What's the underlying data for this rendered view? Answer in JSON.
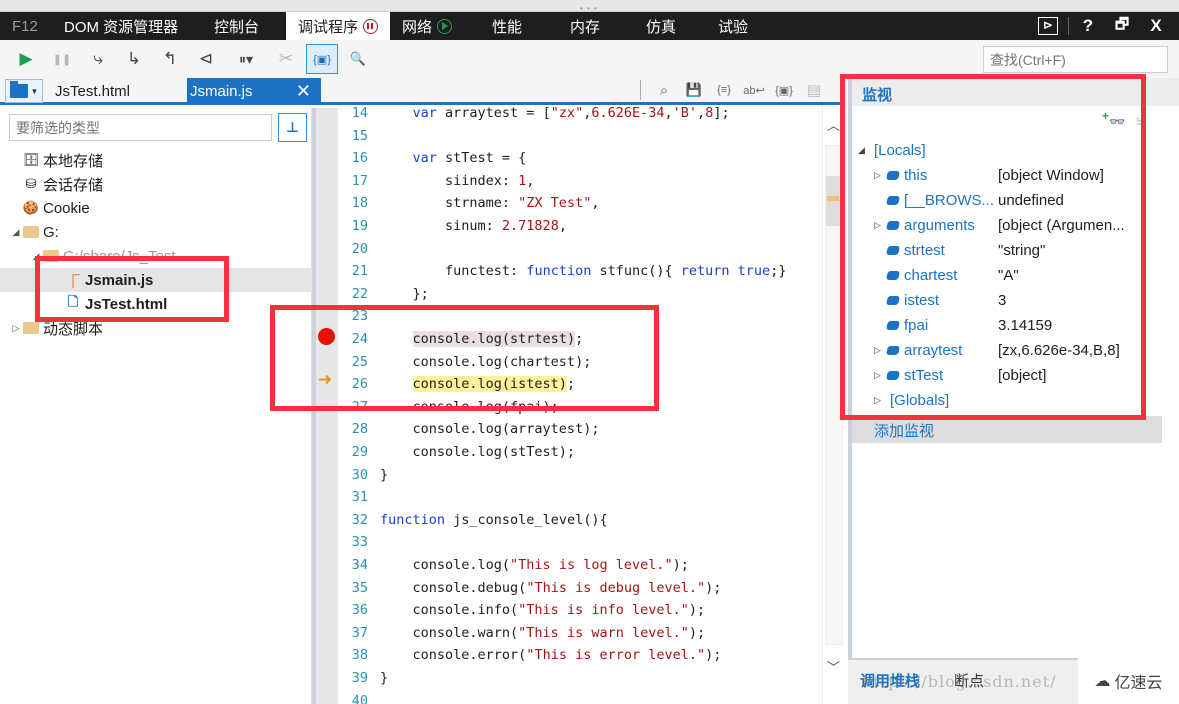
{
  "menubar": {
    "f12": "F12",
    "tabs": [
      "DOM 资源管理器",
      "控制台",
      "调试程序",
      "网络",
      "性能",
      "内存",
      "仿真",
      "试验"
    ],
    "active_tab": "调试程序",
    "right_icons": [
      "console-icon",
      "help-icon",
      "undock-icon",
      "close-icon"
    ],
    "right_glyphs": [
      "⊳",
      "?",
      "🗗",
      "X"
    ]
  },
  "toolbar": {
    "buttons": [
      {
        "name": "continue",
        "glyph": "▶"
      },
      {
        "name": "break-all",
        "glyph": "❚❚"
      },
      {
        "name": "step-into",
        "glyph": "⤷"
      },
      {
        "name": "step-over",
        "glyph": "↳"
      },
      {
        "name": "step-out",
        "glyph": "↰"
      },
      {
        "name": "break-on-new-worker",
        "glyph": "⊲"
      },
      {
        "name": "exception-behavior",
        "glyph": "⏸▾"
      },
      {
        "name": "disconnect-debugger",
        "glyph": "✂"
      },
      {
        "name": "just-my-code",
        "glyph": "{▣}"
      },
      {
        "name": "find-in-files",
        "glyph": "🔍"
      }
    ],
    "find_placeholder": "查找(Ctrl+F)"
  },
  "filetabs": {
    "tabs": [
      {
        "label": "JsTest.html",
        "active": false
      },
      {
        "label": "Jsmain.js",
        "active": true
      }
    ],
    "close_glyph": "✕",
    "editor_icons": [
      "find",
      "save",
      "pretty-print",
      "word-wrap",
      "just-my-code",
      "source-map"
    ],
    "editor_glyphs": [
      "⌕",
      "💾",
      "{≡}",
      "ab↩",
      "{▣}",
      "▤"
    ]
  },
  "left": {
    "filter_placeholder": "要筛选的类型",
    "pin_glyph": "⊥",
    "tree": [
      {
        "label": "本地存储",
        "icon": "local-storage-icon",
        "depth": 1
      },
      {
        "label": "会话存储",
        "icon": "session-storage-icon",
        "depth": 1
      },
      {
        "label": "Cookie",
        "icon": "cookie-icon",
        "depth": 1
      },
      {
        "label": "G:",
        "icon": "folder-icon",
        "depth": 0,
        "expanded": true
      },
      {
        "label": "G:/share/Js_Test",
        "icon": "folder-icon",
        "depth": 1,
        "expanded": true
      },
      {
        "label": "Jsmain.js",
        "icon": "js-file-icon",
        "depth": 2,
        "selected": true
      },
      {
        "label": "JsTest.html",
        "icon": "html-file-icon",
        "depth": 2
      },
      {
        "label": "动态脚本",
        "icon": "folder-icon",
        "depth": 0,
        "expanded": false
      }
    ]
  },
  "code": {
    "breakpoint_line": 24,
    "current_line": 26,
    "lines": [
      {
        "n": "14",
        "html": "    <span class=\"kw\">var</span> arraytest = [<span class=\"str\">\"zx\"</span>,<span class=\"num\">6.626E-34</span>,<span class=\"str\">'B'</span>,<span class=\"num\">8</span>];"
      },
      {
        "n": "15",
        "html": ""
      },
      {
        "n": "16",
        "html": "    <span class=\"kw\">var</span> stTest = {"
      },
      {
        "n": "17",
        "html": "        siindex: <span class=\"num\">1</span>,"
      },
      {
        "n": "18",
        "html": "        strname: <span class=\"str\">\"ZX Test\"</span>,"
      },
      {
        "n": "19",
        "html": "        sinum: <span class=\"num\">2.71828</span>,"
      },
      {
        "n": "20",
        "html": ""
      },
      {
        "n": "21",
        "html": "        functest: <span class=\"kw\">function</span> stfunc(){ <span class=\"kw\">return</span> <span class=\"kw\">true</span>;}"
      },
      {
        "n": "22",
        "html": "    };"
      },
      {
        "n": "23",
        "html": ""
      },
      {
        "n": "24",
        "html": "    <span class=\"hl-bp\">console.log(strtest)</span>;"
      },
      {
        "n": "25",
        "html": "    console.log(chartest);"
      },
      {
        "n": "26",
        "html": "    <span class=\"hl-cur\">console.log(istest)</span>;"
      },
      {
        "n": "27",
        "html": "    console.log(fpai);"
      },
      {
        "n": "28",
        "html": "    console.log(arraytest);"
      },
      {
        "n": "29",
        "html": "    console.log(stTest);"
      },
      {
        "n": "30",
        "html": "}"
      },
      {
        "n": "31",
        "html": ""
      },
      {
        "n": "32",
        "html": "<span class=\"kw\">function</span> js_console_level(){"
      },
      {
        "n": "33",
        "html": ""
      },
      {
        "n": "34",
        "html": "    console.log(<span class=\"str\">\"This is log level.\"</span>);"
      },
      {
        "n": "35",
        "html": "    console.debug(<span class=\"str\">\"This is debug level.\"</span>);"
      },
      {
        "n": "36",
        "html": "    console.info(<span class=\"str\">\"This is info level.\"</span>);"
      },
      {
        "n": "37",
        "html": "    console.warn(<span class=\"str\">\"This is warn level.\"</span>);"
      },
      {
        "n": "38",
        "html": "    console.error(<span class=\"str\">\"This is error level.\"</span>);"
      },
      {
        "n": "39",
        "html": "}"
      },
      {
        "n": "40",
        "html": ""
      }
    ]
  },
  "watch": {
    "title": "监视",
    "add_watch_glyph": "👓",
    "collapse_glyph": "≒",
    "rows": [
      {
        "name": "[Locals]",
        "value": "",
        "depth": 0,
        "expander": "◢",
        "gem": false
      },
      {
        "name": "this",
        "value": "[object Window]",
        "depth": 1,
        "expander": "▷",
        "gem": true
      },
      {
        "name": "[__BROWS...",
        "value": "undefined",
        "depth": 1,
        "expander": "",
        "gem": true
      },
      {
        "name": "arguments",
        "value": "[object (Argumen...",
        "depth": 1,
        "expander": "▷",
        "gem": true
      },
      {
        "name": "strtest",
        "value": "\"string\"",
        "depth": 1,
        "expander": "",
        "gem": true
      },
      {
        "name": "chartest",
        "value": "\"A\"",
        "depth": 1,
        "expander": "",
        "gem": true
      },
      {
        "name": "istest",
        "value": "3",
        "depth": 1,
        "expander": "",
        "gem": true
      },
      {
        "name": "fpai",
        "value": "3.14159",
        "depth": 1,
        "expander": "",
        "gem": true
      },
      {
        "name": "arraytest",
        "value": "[zx,6.626e-34,B,8]",
        "depth": 1,
        "expander": "▷",
        "gem": true
      },
      {
        "name": "stTest",
        "value": "[object]",
        "depth": 1,
        "expander": "▷",
        "gem": true
      },
      {
        "name": "[Globals]",
        "value": "",
        "depth": 0.5,
        "expander": "▷",
        "gem": false
      }
    ],
    "add_watch_label": "添加监视"
  },
  "bottom_tabs": {
    "call_stack": "调用堆栈",
    "breakpoints": "断点"
  },
  "watermark": {
    "url": "https://blog.csdn.net/",
    "brand": "亿速云",
    "brand_glyph": "☁"
  }
}
